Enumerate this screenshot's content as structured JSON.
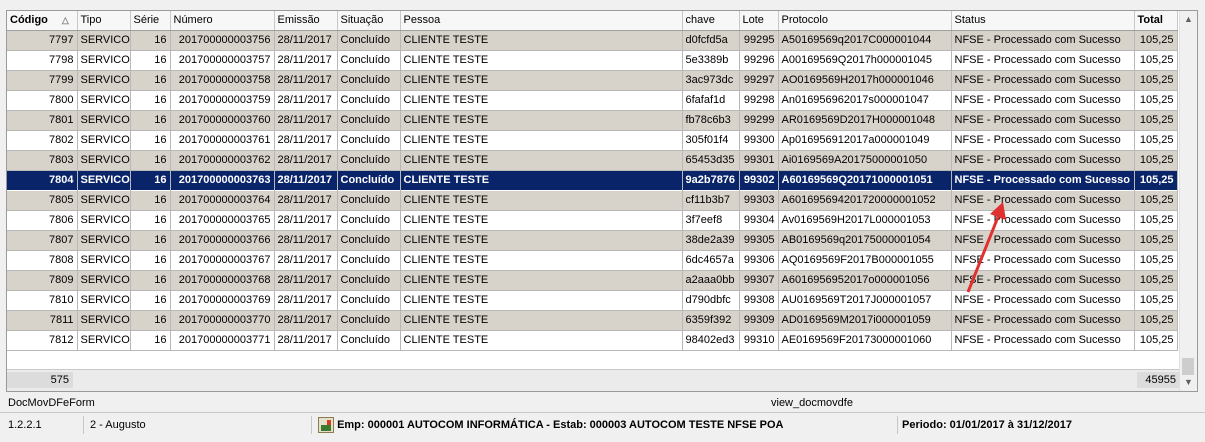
{
  "columns": [
    {
      "label": "Código",
      "bold": true
    },
    {
      "label": "Tipo",
      "bold": false
    },
    {
      "label": "Série",
      "bold": false
    },
    {
      "label": "Número",
      "bold": false
    },
    {
      "label": "Emissão",
      "bold": false
    },
    {
      "label": "Situação",
      "bold": false
    },
    {
      "label": "Pessoa",
      "bold": false
    },
    {
      "label": "chave",
      "bold": false
    },
    {
      "label": "Lote",
      "bold": false
    },
    {
      "label": "Protocolo",
      "bold": false
    },
    {
      "label": "Status",
      "bold": false
    },
    {
      "label": "Total",
      "bold": true
    }
  ],
  "sort_icon": "sort-ascending-icon",
  "rows": [
    [
      "7797",
      "SERVICO",
      "16",
      "201700000003756",
      "28/11/2017",
      "Concluído",
      "CLIENTE TESTE",
      "d0fcfd5a",
      "99295",
      "A50169569q2017C000001044",
      "NFSE - Processado com Sucesso",
      "105,25"
    ],
    [
      "7798",
      "SERVICO",
      "16",
      "201700000003757",
      "28/11/2017",
      "Concluído",
      "CLIENTE TESTE",
      "5e3389b",
      "99296",
      "A00169569Q2017h000001045",
      "NFSE - Processado com Sucesso",
      "105,25"
    ],
    [
      "7799",
      "SERVICO",
      "16",
      "201700000003758",
      "28/11/2017",
      "Concluído",
      "CLIENTE TESTE",
      "3ac973dc",
      "99297",
      "AO0169569H2017h000001046",
      "NFSE - Processado com Sucesso",
      "105,25"
    ],
    [
      "7800",
      "SERVICO",
      "16",
      "201700000003759",
      "28/11/2017",
      "Concluído",
      "CLIENTE TESTE",
      "6fafaf1d",
      "99298",
      "An016956962017s000001047",
      "NFSE - Processado com Sucesso",
      "105,25"
    ],
    [
      "7801",
      "SERVICO",
      "16",
      "201700000003760",
      "28/11/2017",
      "Concluído",
      "CLIENTE TESTE",
      "fb78c6b3",
      "99299",
      "AR0169569D2017H000001048",
      "NFSE - Processado com Sucesso",
      "105,25"
    ],
    [
      "7802",
      "SERVICO",
      "16",
      "201700000003761",
      "28/11/2017",
      "Concluído",
      "CLIENTE TESTE",
      "305f01f4",
      "99300",
      "Ap016956912017a000001049",
      "NFSE - Processado com Sucesso",
      "105,25"
    ],
    [
      "7803",
      "SERVICO",
      "16",
      "201700000003762",
      "28/11/2017",
      "Concluído",
      "CLIENTE TESTE",
      "65453d35",
      "99301",
      "Ai0169569A20175000001050",
      "NFSE - Processado com Sucesso",
      "105,25"
    ],
    [
      "7804",
      "SERVICO",
      "16",
      "201700000003763",
      "28/11/2017",
      "Concluído",
      "CLIENTE TESTE",
      "9a2b7876",
      "99302",
      "A60169569Q20171000001051",
      "NFSE - Processado com Sucesso",
      "105,25"
    ],
    [
      "7805",
      "SERVICO",
      "16",
      "201700000003764",
      "28/11/2017",
      "Concluído",
      "CLIENTE TESTE",
      "cf11b3b7",
      "99303",
      "A601695694201720000001052",
      "NFSE - Processado com Sucesso",
      "105,25"
    ],
    [
      "7806",
      "SERVICO",
      "16",
      "201700000003765",
      "28/11/2017",
      "Concluído",
      "CLIENTE TESTE",
      "3f7eef8",
      "99304",
      "Av0169569H2017L000001053",
      "NFSE - Processado com Sucesso",
      "105,25"
    ],
    [
      "7807",
      "SERVICO",
      "16",
      "201700000003766",
      "28/11/2017",
      "Concluído",
      "CLIENTE TESTE",
      "38de2a39",
      "99305",
      "AB0169569q20175000001054",
      "NFSE - Processado com Sucesso",
      "105,25"
    ],
    [
      "7808",
      "SERVICO",
      "16",
      "201700000003767",
      "28/11/2017",
      "Concluído",
      "CLIENTE TESTE",
      "6dc4657a",
      "99306",
      "AQ0169569F2017B000001055",
      "NFSE - Processado com Sucesso",
      "105,25"
    ],
    [
      "7809",
      "SERVICO",
      "16",
      "201700000003768",
      "28/11/2017",
      "Concluído",
      "CLIENTE TESTE",
      "a2aaa0bb",
      "99307",
      "A6016956952017o000001056",
      "NFSE - Processado com Sucesso",
      "105,25"
    ],
    [
      "7810",
      "SERVICO",
      "16",
      "201700000003769",
      "28/11/2017",
      "Concluído",
      "CLIENTE TESTE",
      "d790dbfc",
      "99308",
      "AU0169569T2017J000001057",
      "NFSE - Processado com Sucesso",
      "105,25"
    ],
    [
      "7811",
      "SERVICO",
      "16",
      "201700000003770",
      "28/11/2017",
      "Concluído",
      "CLIENTE TESTE",
      "6359f392",
      "99309",
      "AD0169569M2017i000001059",
      "NFSE - Processado com Sucesso",
      "105,25"
    ],
    [
      "7812",
      "SERVICO",
      "16",
      "201700000003771",
      "28/11/2017",
      "Concluído",
      "CLIENTE TESTE",
      "98402ed3",
      "99310",
      "AE0169569F20173000001060",
      "NFSE - Processado com Sucesso",
      "105,25"
    ]
  ],
  "selected_row_index": 7,
  "footer": {
    "count": "575",
    "total": "45955"
  },
  "form_bar": {
    "left": "DocMovDFeForm",
    "right": "view_docmovdfe"
  },
  "status_bar": {
    "version": "1.2.2.1",
    "month": "2 - Augusto",
    "company_icon": "company-icon",
    "company": "Emp: 000001 AUTOCOM INFORMÁTICA - Estab: 000003 AUTOCOM TESTE NFSE POA",
    "period": "Periodo: 01/01/2017 à 31/12/2017"
  },
  "colors": {
    "selection": "#0a246a",
    "alt_row": "#d8d3ca",
    "arrow": "#e03030"
  }
}
